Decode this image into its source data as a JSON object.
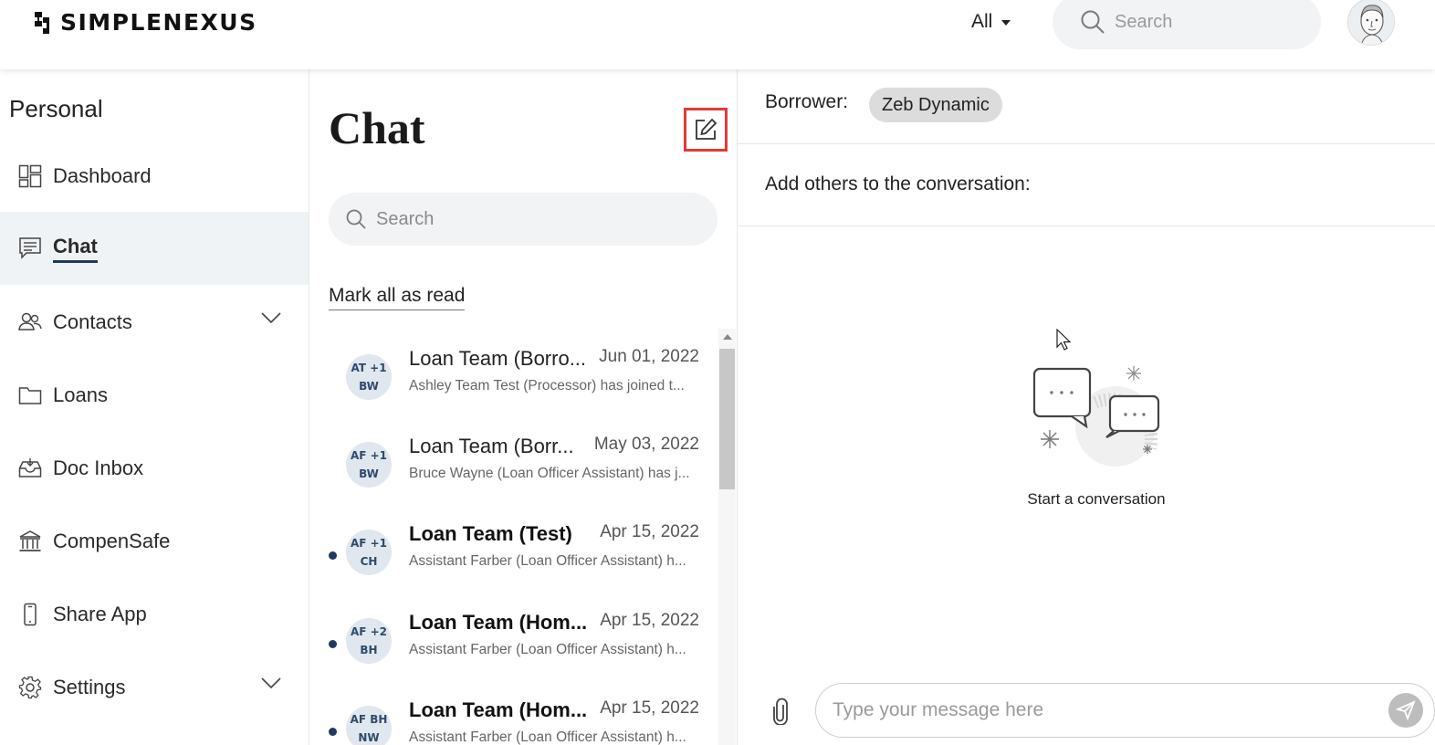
{
  "header": {
    "brand": "SIMPLENEXUS",
    "filter_label": "All",
    "search_placeholder": "Search"
  },
  "sidebar": {
    "section_title": "Personal",
    "items": [
      {
        "label": "Dashboard",
        "icon": "dashboard-icon"
      },
      {
        "label": "Chat",
        "icon": "chat-icon",
        "active": true
      },
      {
        "label": "Contacts",
        "icon": "contacts-icon",
        "expandable": true
      },
      {
        "label": "Loans",
        "icon": "folder-icon"
      },
      {
        "label": "Doc Inbox",
        "icon": "inbox-icon"
      },
      {
        "label": "CompenSafe",
        "icon": "bank-icon"
      },
      {
        "label": "Share App",
        "icon": "phone-icon"
      },
      {
        "label": "Settings",
        "icon": "gear-icon",
        "expandable": true
      }
    ]
  },
  "chat_list": {
    "title": "Chat",
    "search_placeholder": "Search",
    "mark_all_read": "Mark all as read",
    "conversations": [
      {
        "avatar_top": "AT +1",
        "avatar_bottom": "BW",
        "name": "Loan Team (Borro...",
        "date": "Jun 01, 2022",
        "preview": "Ashley Team Test (Processor) has joined t...",
        "unread": false
      },
      {
        "avatar_top": "AF +1",
        "avatar_bottom": "BW",
        "name": "Loan Team (Borr...",
        "date": "May 03, 2022",
        "preview": "Bruce Wayne (Loan Officer Assistant) has j...",
        "unread": false
      },
      {
        "avatar_top": "AF +1",
        "avatar_bottom": "CH",
        "name": "Loan Team (Test)",
        "date": "Apr 15, 2022",
        "preview": "Assistant Farber (Loan Officer Assistant) h...",
        "unread": true
      },
      {
        "avatar_top": "AF +2",
        "avatar_bottom": "BH",
        "name": "Loan Team (Hom...",
        "date": "Apr 15, 2022",
        "preview": "Assistant Farber (Loan Officer Assistant) h...",
        "unread": true
      },
      {
        "avatar_top": "AF BH",
        "avatar_bottom": "NW",
        "name": "Loan Team (Hom...",
        "date": "Apr 15, 2022",
        "preview": "Assistant Farber (Loan Officer Assistant) h...",
        "unread": true
      }
    ]
  },
  "conversation": {
    "borrower_label": "Borrower:",
    "borrower_name": "Zeb Dynamic",
    "add_others_label": "Add others to the conversation:",
    "empty_state_text": "Start a conversation",
    "message_placeholder": "Type your message here"
  },
  "colors": {
    "accent_navy": "#1f3a5f",
    "compose_highlight": "#e53935",
    "active_bg": "#f0f3f5"
  }
}
